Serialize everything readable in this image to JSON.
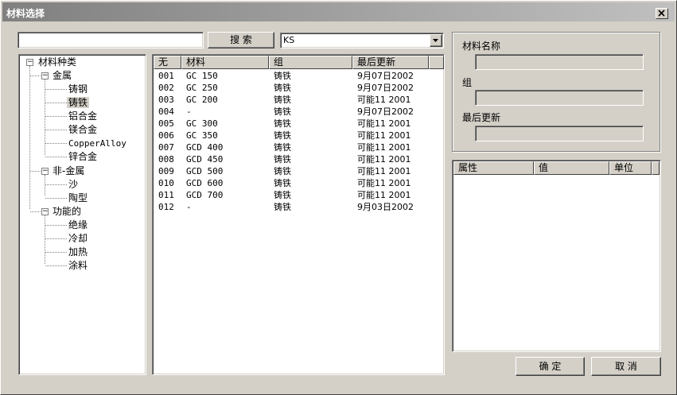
{
  "window": {
    "title": "材料选择"
  },
  "search": {
    "value": "",
    "button_label": "搜 索",
    "combo_value": "KS"
  },
  "tree": {
    "root": "材料种类",
    "groups": [
      {
        "label": "金属",
        "items": [
          "铸钢",
          "铸铁",
          "铝合金",
          "镁合金",
          "CopperAlloy",
          "锌合金"
        ],
        "selected_index": 1
      },
      {
        "label": "非-金属",
        "items": [
          "沙",
          "陶型"
        ]
      },
      {
        "label": "功能的",
        "items": [
          "绝缘",
          "冷却",
          "加热",
          "涂料"
        ]
      }
    ]
  },
  "materials": {
    "headers": [
      "无",
      "材料",
      "组",
      "最后更新"
    ],
    "rows": [
      [
        "001",
        "GC 150",
        "铸铁",
        "9月07日2002"
      ],
      [
        "002",
        "GC 250",
        "铸铁",
        "9月07日2002"
      ],
      [
        "003",
        "GC 200",
        "铸铁",
        "可能11 2001"
      ],
      [
        "004",
        "-",
        "铸铁",
        "9月07日2002"
      ],
      [
        "005",
        "GC 300",
        "铸铁",
        "可能11 2001"
      ],
      [
        "006",
        "GC 350",
        "铸铁",
        "可能11 2001"
      ],
      [
        "007",
        "GCD 400",
        "铸铁",
        "可能11 2001"
      ],
      [
        "008",
        "GCD 450",
        "铸铁",
        "可能11 2001"
      ],
      [
        "009",
        "GCD 500",
        "铸铁",
        "可能11 2001"
      ],
      [
        "010",
        "GCD 600",
        "铸铁",
        "可能11 2001"
      ],
      [
        "011",
        "GCD 700",
        "铸铁",
        "可能11 2001"
      ],
      [
        "012",
        "-",
        "铸铁",
        "9月03日2002"
      ]
    ]
  },
  "details": {
    "name_label": "材料名称",
    "group_label": "组",
    "updated_label": "最后更新"
  },
  "properties": {
    "headers": [
      "属性",
      "值",
      "单位"
    ]
  },
  "buttons": {
    "ok": "确 定",
    "cancel": "取 消"
  }
}
